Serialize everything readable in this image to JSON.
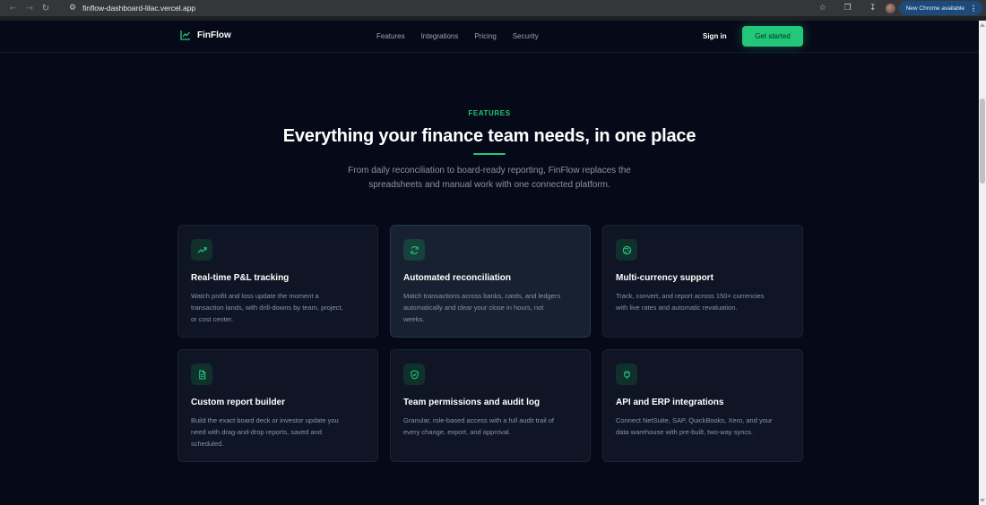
{
  "browser": {
    "url": "finflow-dashboard-lilac.vercel.app",
    "update_label": "New Chrome available"
  },
  "nav": {
    "brand": "FinFlow",
    "links": [
      "Features",
      "Integrations",
      "Pricing",
      "Security"
    ],
    "signin": "Sign in",
    "cta": "Get started"
  },
  "hero": {
    "eyebrow": "FEATURES",
    "headline": "Everything your finance team needs, in one place",
    "subtitle_line1": "From daily reconciliation to board-ready reporting, FinFlow replaces the",
    "subtitle_line2": "spreadsheets and manual work with one connected platform."
  },
  "features": [
    {
      "icon": "trending-up-icon",
      "title": "Real-time P&L tracking",
      "lines": [
        "Watch profit and loss update the moment a",
        "transaction lands, with drill-downs by team, project,",
        "or cost center."
      ]
    },
    {
      "icon": "refresh-icon",
      "title": "Automated reconciliation",
      "lines": [
        "Match transactions across banks, cards, and ledgers",
        "automatically and clear your close in hours, not",
        "weeks."
      ]
    },
    {
      "icon": "globe-icon",
      "title": "Multi-currency support",
      "lines": [
        "Track, convert, and report across 150+ currencies",
        "with live rates and automatic revaluation."
      ]
    },
    {
      "icon": "document-icon",
      "title": "Custom report builder",
      "lines": [
        "Build the exact board deck or investor update you",
        "need with drag-and-drop reports, saved and",
        "scheduled."
      ]
    },
    {
      "icon": "shield-check-icon",
      "title": "Team permissions and audit log",
      "lines": [
        "Granular, role-based access with a full audit trail of",
        "every change, export, and approval."
      ]
    },
    {
      "icon": "plug-icon",
      "title": "API and ERP integrations",
      "lines": [
        "Connect NetSuite, SAP, QuickBooks, Xero, and your",
        "data warehouse with pre-built, two-way syncs."
      ]
    }
  ],
  "colors": {
    "accent": "#22c77a",
    "background": "#060a18",
    "card": "#0f1524"
  }
}
